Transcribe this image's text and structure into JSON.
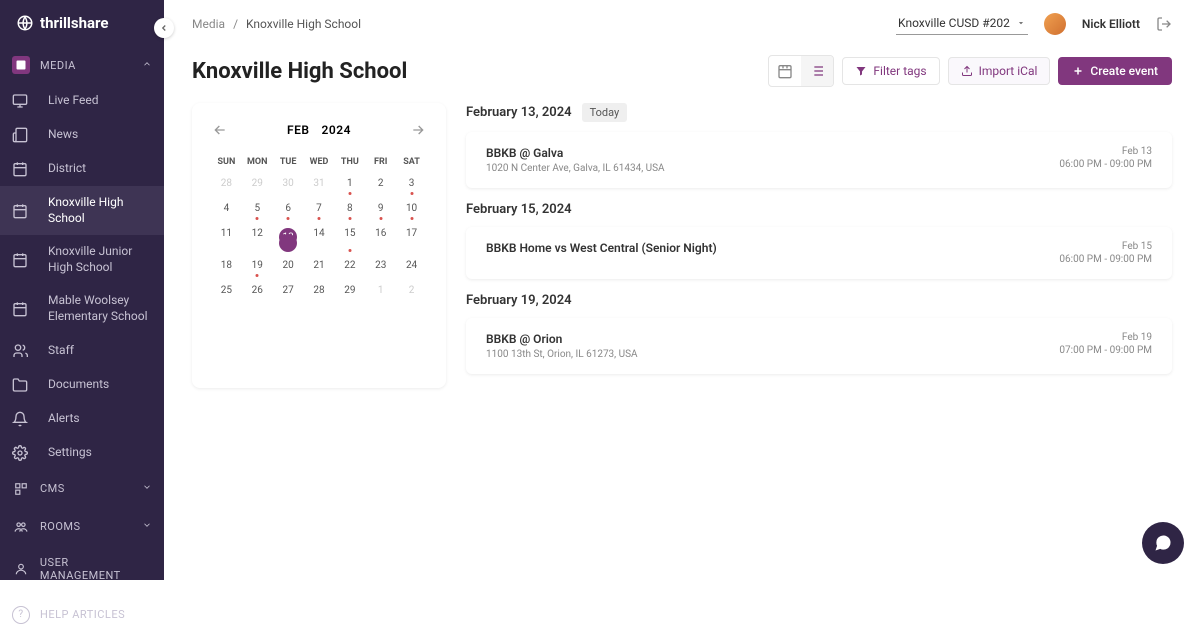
{
  "brand": "thrillshare",
  "sidebar": {
    "sections": {
      "media": "MEDIA",
      "cms": "CMS",
      "rooms": "ROOMS",
      "user_mgmt": "USER MANAGEMENT"
    },
    "media_items": [
      {
        "label": "Live Feed"
      },
      {
        "label": "News"
      },
      {
        "label": "District"
      },
      {
        "label": "Knoxville High School"
      },
      {
        "label": "Knoxville Junior High School"
      },
      {
        "label": "Mable Woolsey Elementary School"
      },
      {
        "label": "Staff"
      },
      {
        "label": "Documents"
      },
      {
        "label": "Alerts"
      },
      {
        "label": "Settings"
      }
    ],
    "help": "HELP ARTICLES"
  },
  "breadcrumb": {
    "root": "Media",
    "current": "Knoxville High School"
  },
  "org": "Knoxville CUSD #202",
  "user": "Nick Elliott",
  "page_title": "Knoxville High School",
  "toolbar": {
    "filter": "Filter tags",
    "import": "Import iCal",
    "create": "Create event"
  },
  "calendar": {
    "month": "FEB",
    "year": "2024",
    "dow": [
      "SUN",
      "MON",
      "TUE",
      "WED",
      "THU",
      "FRI",
      "SAT"
    ],
    "days": [
      {
        "n": "28",
        "other": true
      },
      {
        "n": "29",
        "other": true
      },
      {
        "n": "30",
        "other": true
      },
      {
        "n": "31",
        "other": true
      },
      {
        "n": "1",
        "dot": true
      },
      {
        "n": "2"
      },
      {
        "n": "3",
        "dot": true
      },
      {
        "n": "4"
      },
      {
        "n": "5",
        "dot": true
      },
      {
        "n": "6",
        "dot": true
      },
      {
        "n": "7",
        "dot": true
      },
      {
        "n": "8",
        "dot": true
      },
      {
        "n": "9",
        "dot": true
      },
      {
        "n": "10",
        "dot": true
      },
      {
        "n": "11"
      },
      {
        "n": "12"
      },
      {
        "n": "13",
        "selected": true,
        "dot": true
      },
      {
        "n": "14"
      },
      {
        "n": "15",
        "dot": true
      },
      {
        "n": "16"
      },
      {
        "n": "17"
      },
      {
        "n": "18"
      },
      {
        "n": "19",
        "dot": true
      },
      {
        "n": "20"
      },
      {
        "n": "21"
      },
      {
        "n": "22"
      },
      {
        "n": "23"
      },
      {
        "n": "24"
      },
      {
        "n": "25"
      },
      {
        "n": "26"
      },
      {
        "n": "27"
      },
      {
        "n": "28"
      },
      {
        "n": "29"
      },
      {
        "n": "1",
        "other": true
      },
      {
        "n": "2",
        "other": true
      }
    ]
  },
  "events": [
    {
      "date": "February 13, 2024",
      "today": "Today",
      "items": [
        {
          "title": "BBKB @ Galva",
          "location": "1020 N Center Ave, Galva, IL 61434, USA",
          "short_date": "Feb 13",
          "time": "06:00 PM - 09:00 PM"
        }
      ]
    },
    {
      "date": "February 15, 2024",
      "items": [
        {
          "title": "BBKB Home vs West Central (Senior Night)",
          "location": "",
          "short_date": "Feb 15",
          "time": "06:00 PM - 09:00 PM"
        }
      ]
    },
    {
      "date": "February 19, 2024",
      "items": [
        {
          "title": "BBKB @ Orion",
          "location": "1100 13th St, Orion, IL 61273, USA",
          "short_date": "Feb 19",
          "time": "07:00 PM - 09:00 PM"
        }
      ]
    }
  ]
}
